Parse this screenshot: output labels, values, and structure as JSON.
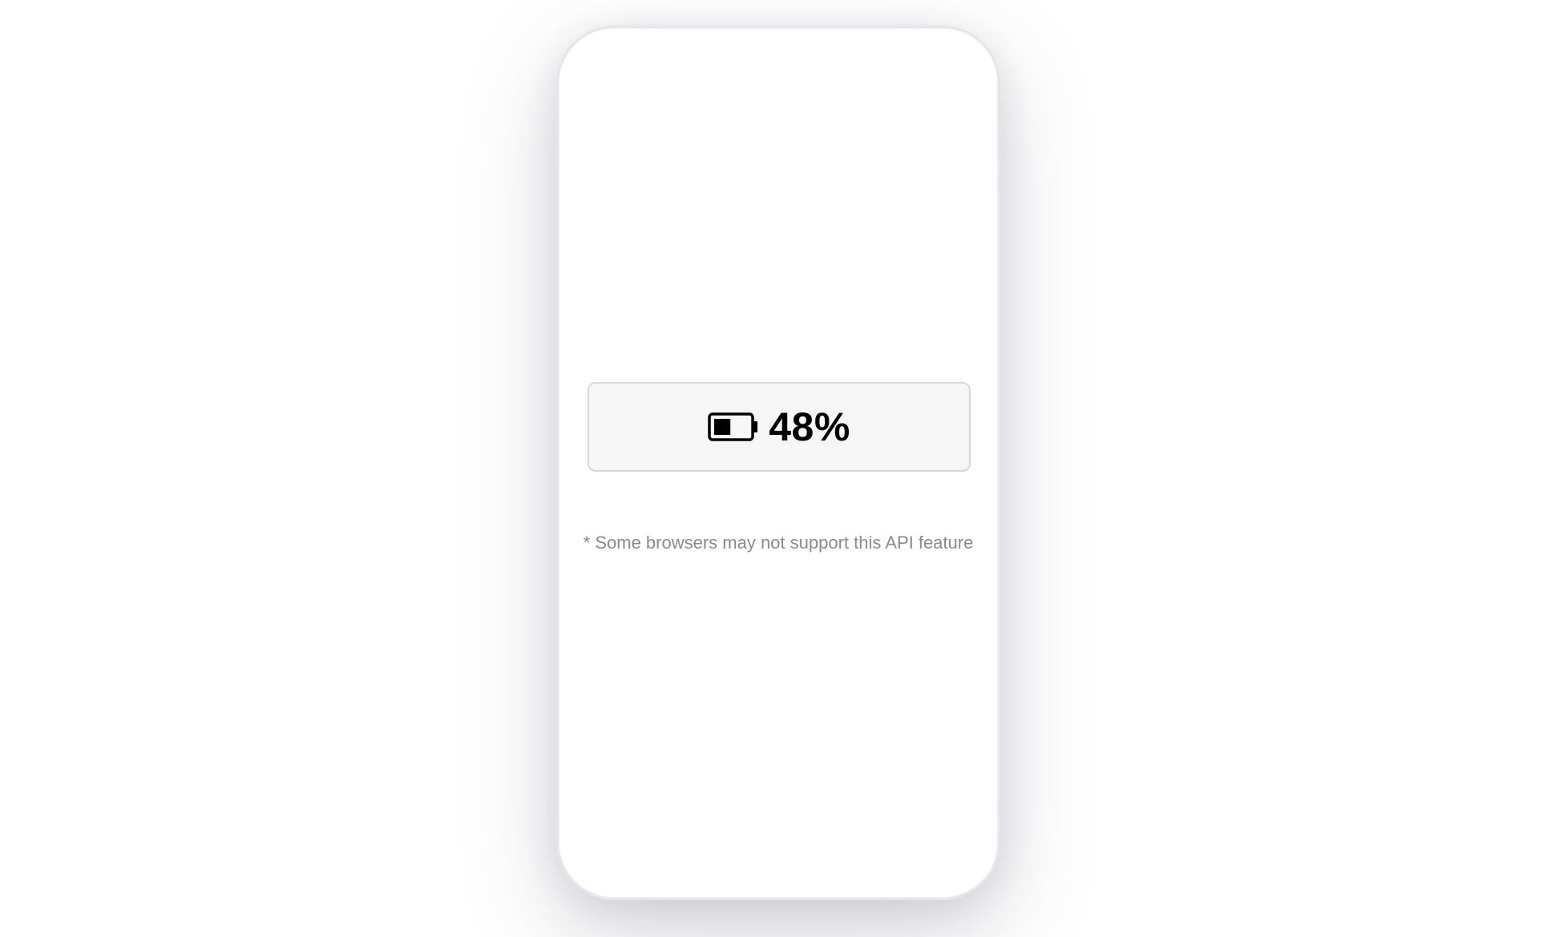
{
  "battery": {
    "level_percent": 48,
    "label": "48%",
    "icon": "battery-half-icon"
  },
  "footnote": {
    "text": "* Some browsers may not support this API feature"
  },
  "colors": {
    "text_primary": "#000000",
    "text_muted": "#8a8a8a",
    "card_background": "#f6f6f6",
    "card_border": "#d7d7d7"
  }
}
